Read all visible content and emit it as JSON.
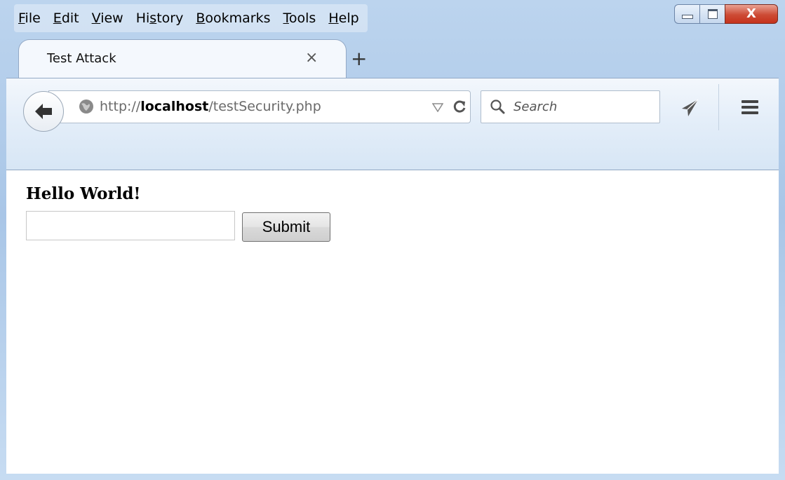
{
  "menubar": {
    "items": [
      {
        "prefix": "",
        "ul": "F",
        "rest": "ile"
      },
      {
        "prefix": "",
        "ul": "E",
        "rest": "dit"
      },
      {
        "prefix": "",
        "ul": "V",
        "rest": "iew"
      },
      {
        "prefix": "Hi",
        "ul": "s",
        "rest": "tory"
      },
      {
        "prefix": "",
        "ul": "B",
        "rest": "ookmarks"
      },
      {
        "prefix": "",
        "ul": "T",
        "rest": "ools"
      },
      {
        "prefix": "",
        "ul": "H",
        "rest": "elp"
      }
    ]
  },
  "window_controls": {
    "close_glyph": "X"
  },
  "tabs": [
    {
      "title": "Test Attack",
      "close_glyph": "×"
    }
  ],
  "newtab_glyph": "+",
  "urlbar": {
    "scheme": "http://",
    "host": "localhost",
    "path": "/testSecurity.php"
  },
  "search": {
    "placeholder": "Search"
  },
  "page": {
    "heading": "Hello World!",
    "input_value": "",
    "submit_label": "Submit"
  },
  "colors": {
    "close_button": "#c5321c",
    "chrome_blue": "#d7e6f5",
    "back_arrow": "#333333"
  }
}
